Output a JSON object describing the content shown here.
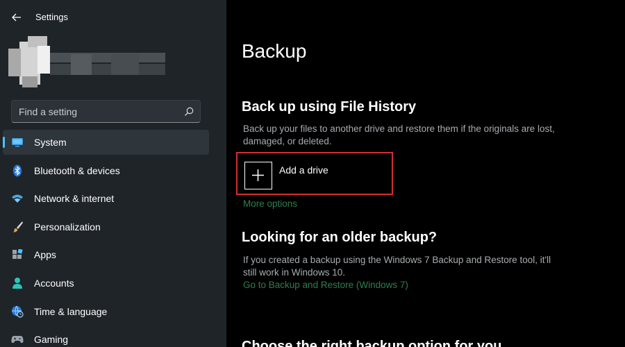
{
  "window": {
    "title": "Settings"
  },
  "search": {
    "placeholder": "Find a setting",
    "value": ""
  },
  "sidebar": {
    "items": [
      {
        "label": "System",
        "icon": "monitor-icon",
        "selected": true
      },
      {
        "label": "Bluetooth & devices",
        "icon": "bluetooth-icon",
        "selected": false
      },
      {
        "label": "Network & internet",
        "icon": "wifi-icon",
        "selected": false
      },
      {
        "label": "Personalization",
        "icon": "brush-icon",
        "selected": false
      },
      {
        "label": "Apps",
        "icon": "apps-icon",
        "selected": false
      },
      {
        "label": "Accounts",
        "icon": "person-icon",
        "selected": false
      },
      {
        "label": "Time & language",
        "icon": "globe-clock-icon",
        "selected": false
      },
      {
        "label": "Gaming",
        "icon": "gamepad-icon",
        "selected": false
      }
    ]
  },
  "main": {
    "title": "Backup",
    "file_history": {
      "heading": "Back up using File History",
      "description": "Back up your files to another drive and restore them if the originals are lost, damaged, or deleted.",
      "add_drive_label": "Add a drive",
      "more_options": "More options"
    },
    "older_backup": {
      "heading": "Looking for an older backup?",
      "description": "If you created a backup using the Windows 7 Backup and Restore tool, it'll still work in Windows 10.",
      "link": "Go to Backup and Restore (Windows 7)"
    },
    "next_heading": "Choose the right backup option for you"
  },
  "colors": {
    "accent": "#4cc2ff",
    "link": "#2e7f52",
    "highlight_border": "#d32f2f",
    "sidebar_bg": "#1f2429",
    "main_bg": "#000000"
  }
}
